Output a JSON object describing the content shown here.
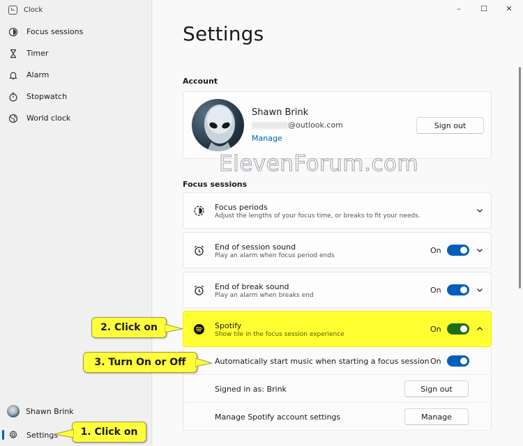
{
  "app": {
    "title": "Clock"
  },
  "window": {
    "min": "–",
    "max": "☐",
    "close": "✕"
  },
  "sidebar": {
    "items": [
      {
        "label": "Focus sessions",
        "icon": "focus-icon"
      },
      {
        "label": "Timer",
        "icon": "hourglass-icon"
      },
      {
        "label": "Alarm",
        "icon": "bell-icon"
      },
      {
        "label": "Stopwatch",
        "icon": "stopwatch-icon"
      },
      {
        "label": "World clock",
        "icon": "globe-icon"
      }
    ],
    "user": "Shawn Brink",
    "settings": "Settings"
  },
  "page": {
    "title": "Settings"
  },
  "account": {
    "section": "Account",
    "name": "Shawn Brink",
    "email_suffix": "@outlook.com",
    "manage": "Manage",
    "sign_out": "Sign out"
  },
  "watermark": "ElevenForum.com",
  "focus": {
    "section": "Focus sessions",
    "periods": {
      "title": "Focus periods",
      "desc": "Adjust the lengths of your focus time, or breaks to fit your needs."
    },
    "end_session": {
      "title": "End of session sound",
      "desc": "Play an alarm when focus period ends",
      "state": "On"
    },
    "end_break": {
      "title": "End of break sound",
      "desc": "Play an alarm when breaks end",
      "state": "On"
    },
    "spotify": {
      "title": "Spotify",
      "desc": "Show tile in the focus session experience",
      "state": "On"
    },
    "auto_music": {
      "label": "Automatically start music when starting a focus session",
      "state": "On"
    },
    "signed_in": {
      "label": "Signed in as: Brink",
      "button": "Sign out"
    },
    "manage_spotify": {
      "label": "Manage Spotify account settings",
      "button": "Manage"
    }
  },
  "callouts": {
    "c1": "1. Click on",
    "c2": "2. Click on",
    "c3": "3. Turn On or Off"
  },
  "colors": {
    "accent": "#005fb8",
    "highlight": "#ffff32",
    "spotify_toggle": "#1e6e18"
  }
}
